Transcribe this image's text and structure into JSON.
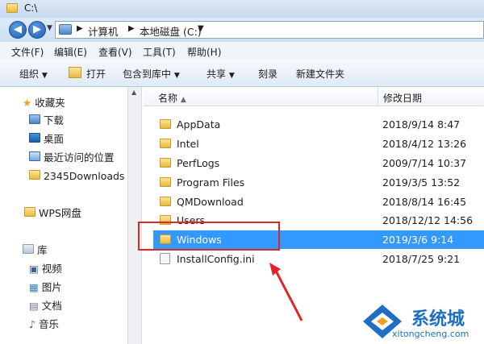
{
  "window": {
    "title": "C:\\"
  },
  "address": {
    "segments": [
      "计算机",
      "本地磁盘 (C:)"
    ]
  },
  "menu": [
    "文件(F)",
    "编辑(E)",
    "查看(V)",
    "工具(T)",
    "帮助(H)"
  ],
  "commands": [
    "组织",
    "打开",
    "包含到库中",
    "共享",
    "刻录",
    "新建文件夹"
  ],
  "nav": {
    "favorites": {
      "label": "收藏夹",
      "items": [
        "下载",
        "桌面",
        "最近访问的位置",
        "2345Downloads"
      ]
    },
    "wps": "WPS网盘",
    "library": {
      "label": "库",
      "items": [
        "视频",
        "图片",
        "文档",
        "音乐"
      ]
    }
  },
  "columns": {
    "name": "名称",
    "date": "修改日期"
  },
  "files": [
    {
      "name": "AppData",
      "date": "2018/9/14 8:47",
      "type": "folder"
    },
    {
      "name": "Intel",
      "date": "2018/4/12 13:26",
      "type": "folder"
    },
    {
      "name": "PerfLogs",
      "date": "2009/7/14 10:37",
      "type": "folder"
    },
    {
      "name": "Program Files",
      "date": "2019/3/5 13:52",
      "type": "folder"
    },
    {
      "name": "QMDownload",
      "date": "2018/8/14 16:45",
      "type": "folder"
    },
    {
      "name": "Users",
      "date": "2018/12/12 14:56",
      "type": "folder"
    },
    {
      "name": "Windows",
      "date": "2019/3/6 9:14",
      "type": "folder",
      "selected": true
    },
    {
      "name": "InstallConfig.ini",
      "date": "2018/7/25 9:21",
      "type": "file"
    }
  ],
  "watermark": {
    "brand": "系统城",
    "url": "xitongcheng.com"
  },
  "colors": {
    "selection": "#3399ff",
    "annotation": "#e0262a",
    "brand": "#1e6fc4"
  }
}
